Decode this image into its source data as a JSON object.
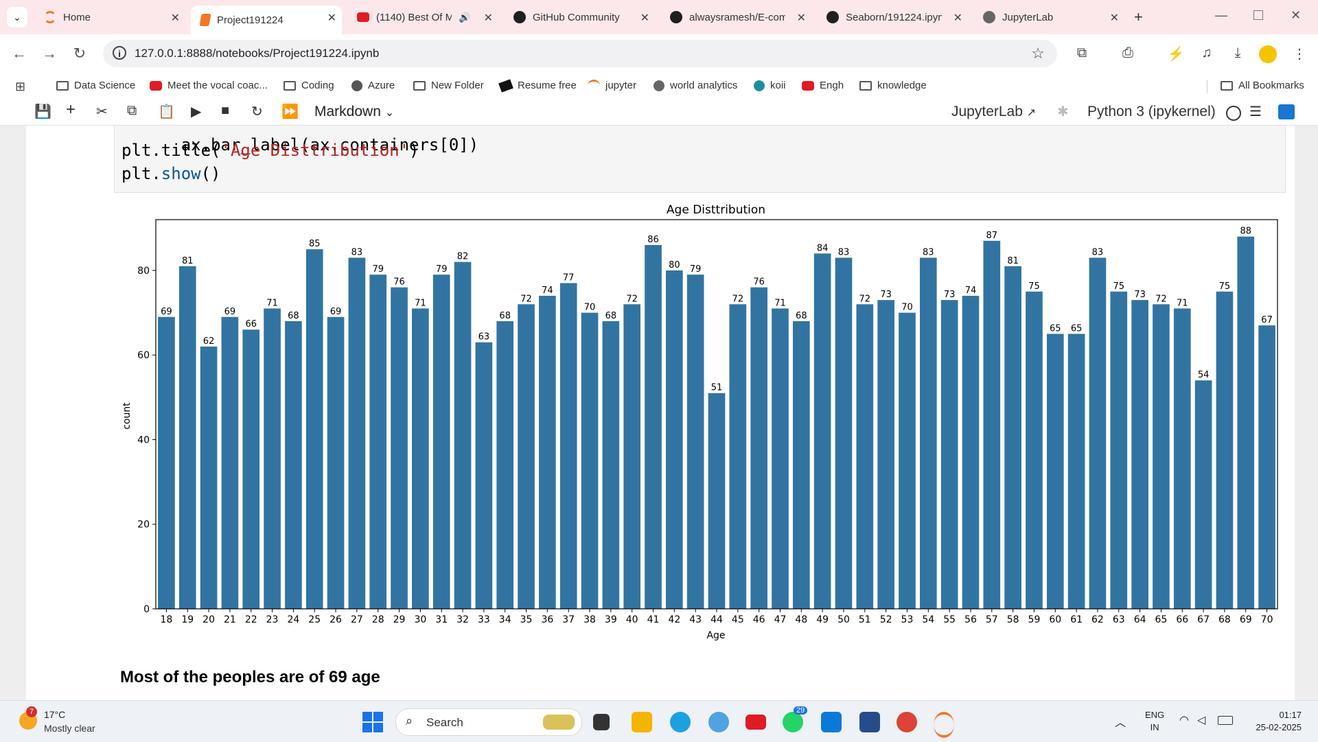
{
  "browser": {
    "tabs": [
      {
        "title": "Home",
        "icon": "jupyter-icon",
        "active": false
      },
      {
        "title": "Project191224",
        "icon": "notebook-icon",
        "active": true
      },
      {
        "title": "(1140) Best Of M",
        "icon": "youtube-icon",
        "active": false
      },
      {
        "title": "GitHub Community C",
        "icon": "github-icon",
        "active": false
      },
      {
        "title": "alwaysramesh/E-com",
        "icon": "github-icon",
        "active": false
      },
      {
        "title": "Seaborn/191224.ipyn",
        "icon": "github-icon",
        "active": false
      },
      {
        "title": "JupyterLab",
        "icon": "globe-icon",
        "active": false
      }
    ],
    "url": "127.0.0.1:8888/notebooks/Project191224.ipynb",
    "bookmarks": [
      {
        "label": "Data Science",
        "icon": "folder-icon"
      },
      {
        "label": "Meet the vocal coac...",
        "icon": "youtube-icon"
      },
      {
        "label": "Coding",
        "icon": "folder-icon"
      },
      {
        "label": "Azure",
        "icon": "globe-icon"
      },
      {
        "label": "New Folder",
        "icon": "folder-icon"
      },
      {
        "label": "Resume free",
        "icon": "resume-icon"
      },
      {
        "label": "jupyter",
        "icon": "jupyter-icon"
      },
      {
        "label": "world analytics",
        "icon": "globe-icon"
      },
      {
        "label": "koii",
        "icon": "koii-icon"
      },
      {
        "label": "Engh",
        "icon": "youtube-icon"
      },
      {
        "label": "knowledge",
        "icon": "folder-icon"
      }
    ],
    "all_bookmarks": "All Bookmarks"
  },
  "jupyter": {
    "cell_type": "Markdown",
    "jupyterlab_label": "JupyterLab",
    "kernel": "Python 3 (ipykernel)"
  },
  "code": {
    "line1": "ax.bar_label(ax.containers[0])",
    "line2_fn": "plt.title(",
    "line2_str": "'Age Disttribution'",
    "line2_end": ")",
    "line3_pre": "plt.",
    "line3_fn": "show",
    "line3_end": "()"
  },
  "chart_data": {
    "type": "bar",
    "title": "Age Disttribution",
    "xlabel": "Age",
    "ylabel": "count",
    "ylim": [
      0,
      92
    ],
    "yticks": [
      0,
      20,
      40,
      60,
      80
    ],
    "bar_color": "#3274a1",
    "categories": [
      "18",
      "19",
      "20",
      "21",
      "22",
      "23",
      "24",
      "25",
      "26",
      "27",
      "28",
      "29",
      "30",
      "31",
      "32",
      "33",
      "34",
      "35",
      "36",
      "37",
      "38",
      "39",
      "40",
      "41",
      "42",
      "43",
      "44",
      "45",
      "46",
      "47",
      "48",
      "49",
      "50",
      "51",
      "52",
      "53",
      "54",
      "55",
      "56",
      "57",
      "58",
      "59",
      "60",
      "61",
      "62",
      "63",
      "64",
      "65",
      "66",
      "67",
      "68",
      "69",
      "70"
    ],
    "values": [
      69,
      81,
      62,
      69,
      66,
      71,
      68,
      85,
      69,
      83,
      79,
      76,
      71,
      79,
      82,
      63,
      68,
      72,
      74,
      77,
      70,
      68,
      72,
      86,
      80,
      79,
      51,
      72,
      76,
      71,
      68,
      84,
      83,
      72,
      73,
      70,
      83,
      73,
      74,
      87,
      81,
      75,
      65,
      65,
      83,
      75,
      73,
      72,
      71,
      54,
      75,
      88,
      67
    ]
  },
  "markdown": {
    "text": "Most of the peoples are of 69 age"
  },
  "taskbar": {
    "weather_temp": "17°C",
    "weather_desc": "Mostly clear",
    "weather_badge": "7",
    "search": "Search",
    "whatsapp_badge": "29",
    "lang1": "ENG",
    "lang2": "IN",
    "time": "01:17",
    "date": "25-02-2025"
  }
}
